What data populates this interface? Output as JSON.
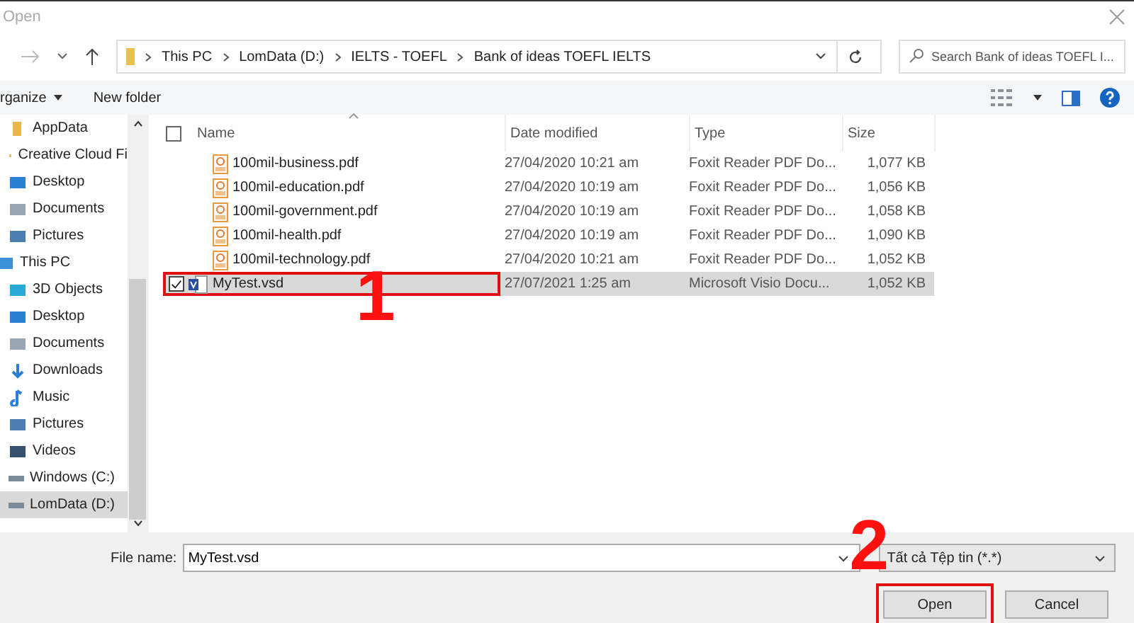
{
  "window": {
    "title": "Open"
  },
  "address": {
    "crumbs": [
      "This PC",
      "LomData (D:)",
      "IELTS - TOEFL",
      "Bank of ideas TOEFL IELTS"
    ]
  },
  "search": {
    "placeholder": "Search Bank of ideas TOEFL I..."
  },
  "toolbar": {
    "organize": "rganize",
    "new_folder": "New folder"
  },
  "sidebar": {
    "items": [
      {
        "label": "AppData",
        "kind": "folder",
        "selected": false
      },
      {
        "label": "Creative Cloud Fi",
        "kind": "folder",
        "selected": false
      },
      {
        "label": "Desktop",
        "kind": "desktop",
        "selected": false
      },
      {
        "label": "Documents",
        "kind": "documents",
        "selected": false
      },
      {
        "label": "Pictures",
        "kind": "pictures",
        "selected": false
      },
      {
        "label": "This PC",
        "kind": "pc",
        "selected": false,
        "children": [
          {
            "label": "3D Objects",
            "kind": "objects",
            "selected": false
          },
          {
            "label": "Desktop",
            "kind": "desktop",
            "selected": false
          },
          {
            "label": "Documents",
            "kind": "documents",
            "selected": false
          },
          {
            "label": "Downloads",
            "kind": "downloads",
            "selected": false
          },
          {
            "label": "Music",
            "kind": "music",
            "selected": false
          },
          {
            "label": "Pictures",
            "kind": "pictures",
            "selected": false
          },
          {
            "label": "Videos",
            "kind": "videos",
            "selected": false
          },
          {
            "label": "Windows (C:)",
            "kind": "windrive",
            "selected": false
          },
          {
            "label": "LomData (D:)",
            "kind": "drive",
            "selected": true
          }
        ]
      }
    ]
  },
  "table": {
    "select_all": {
      "checked": false
    },
    "columns": [
      "Name",
      "Date modified",
      "Type",
      "Size"
    ],
    "rows": [
      {
        "name": "100mil-business.pdf",
        "kind": "pdf",
        "date": "27/04/2020 10:21 am",
        "type": "Foxit Reader PDF Do...",
        "size": "1,077 KB",
        "selected": false,
        "checked": false,
        "highlighted": false
      },
      {
        "name": "100mil-education.pdf",
        "kind": "pdf",
        "date": "27/04/2020 10:19 am",
        "type": "Foxit Reader PDF Do...",
        "size": "1,056 KB",
        "selected": false,
        "checked": false,
        "highlighted": false
      },
      {
        "name": "100mil-government.pdf",
        "kind": "pdf",
        "date": "27/04/2020 10:19 am",
        "type": "Foxit Reader PDF Do...",
        "size": "1,058 KB",
        "selected": false,
        "checked": false,
        "highlighted": false
      },
      {
        "name": "100mil-health.pdf",
        "kind": "pdf",
        "date": "27/04/2020 10:19 am",
        "type": "Foxit Reader PDF Do...",
        "size": "1,090 KB",
        "selected": false,
        "checked": false,
        "highlighted": false
      },
      {
        "name": "100mil-technology.pdf",
        "kind": "pdf",
        "date": "27/04/2020 10:21 am",
        "type": "Foxit Reader PDF Do...",
        "size": "1,052 KB",
        "selected": false,
        "checked": false,
        "highlighted": false
      },
      {
        "name": "MyTest.vsd",
        "kind": "visio",
        "date": "27/07/2021 1:25 am",
        "type": "Microsoft Visio Docu...",
        "size": "1,052 KB",
        "selected": true,
        "checked": true,
        "highlighted": true
      }
    ]
  },
  "bottom": {
    "file_name_label": "File name:",
    "file_name": "MyTest.vsd",
    "filter": "Tất cả Tệp tin (*.*)",
    "buttons": [
      {
        "label": "Open",
        "highlighted": true
      },
      {
        "label": "Cancel",
        "highlighted": false
      }
    ]
  },
  "annotations": [
    "1",
    "2"
  ]
}
